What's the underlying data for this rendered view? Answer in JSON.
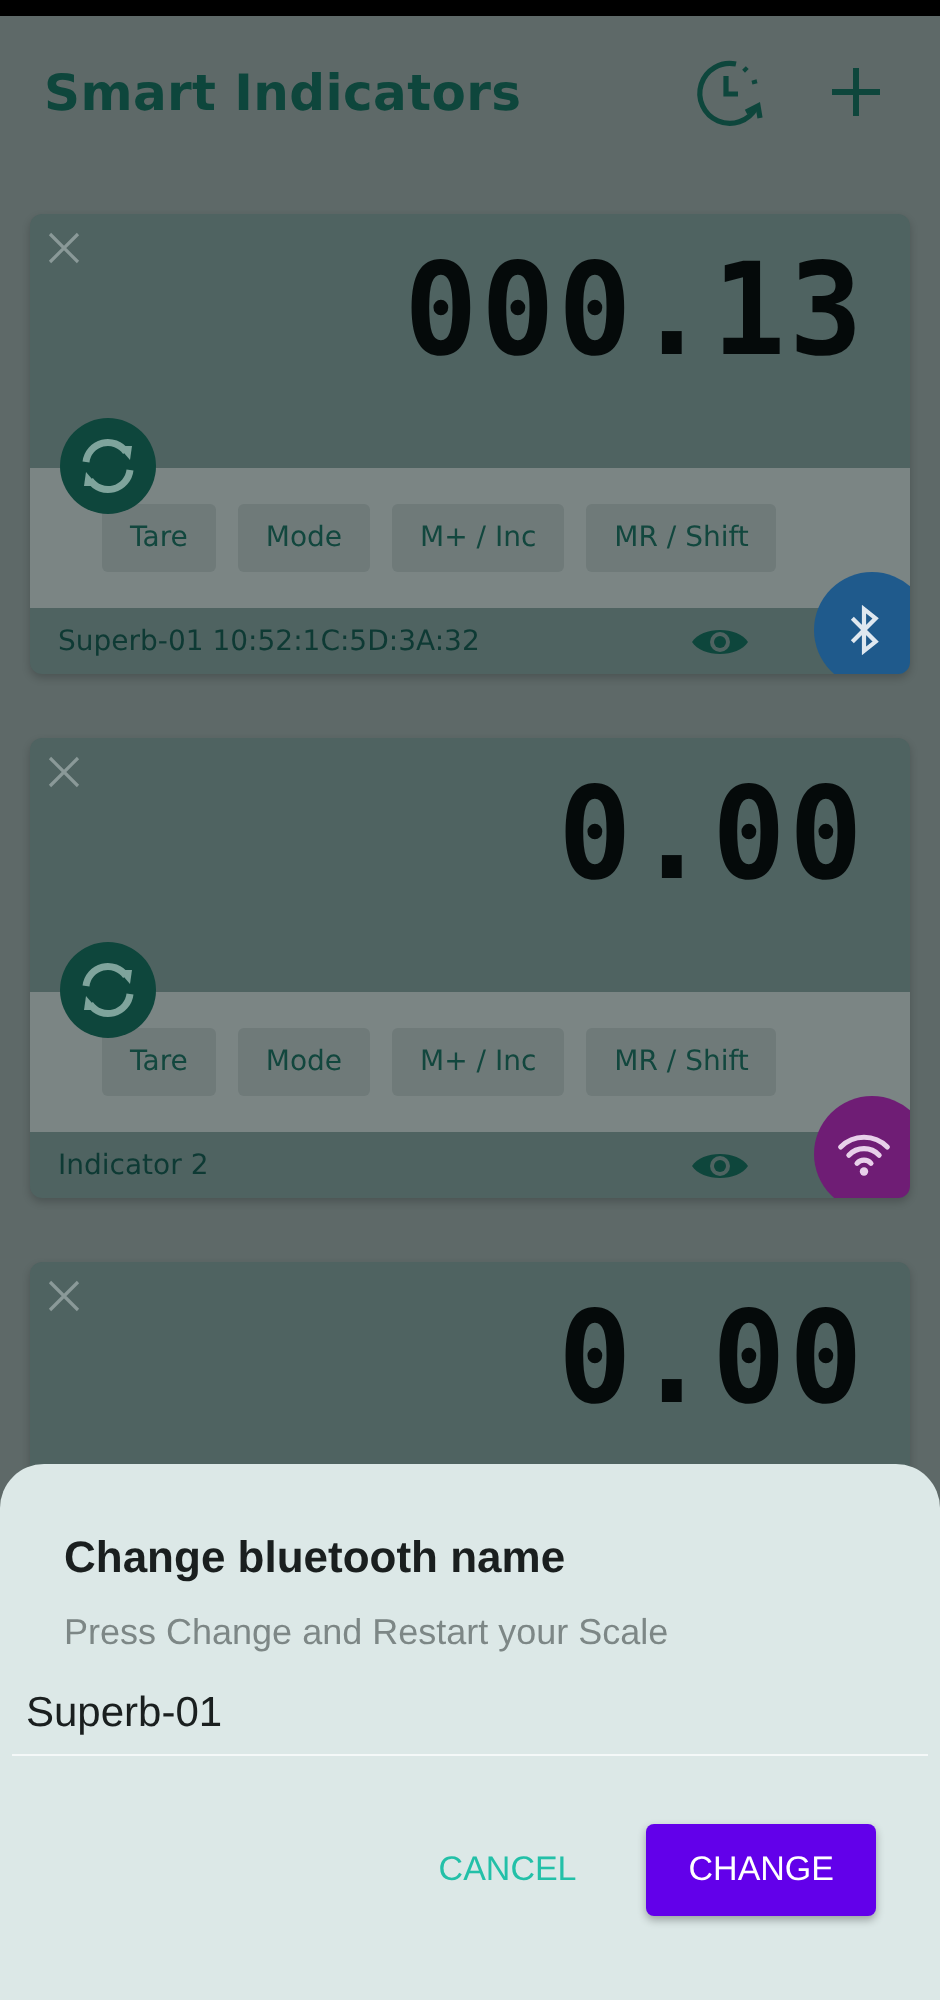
{
  "header": {
    "title": "Smart Indicators"
  },
  "indicators": [
    {
      "reading": "000.13",
      "buttons": [
        "Tare",
        "Mode",
        "M+ / Inc",
        "MR / Shift"
      ],
      "name": "Superb-01 10:52:1C:5D:3A:32",
      "kind": "bluetooth",
      "color": "#1f5a8c"
    },
    {
      "reading": "0.00",
      "buttons": [
        "Tare",
        "Mode",
        "M+ / Inc",
        "MR / Shift"
      ],
      "name": "Indicator 2",
      "kind": "wifi",
      "color": "#6f1d75"
    },
    {
      "reading": "0.00"
    }
  ],
  "dialog": {
    "title": "Change bluetooth name",
    "message": "Press Change and Restart your Scale",
    "field_value": "Superb-01",
    "buttons": [
      {
        "label": "CANCEL",
        "kind": "text"
      },
      {
        "label": "CHANGE",
        "kind": "filled"
      }
    ]
  }
}
